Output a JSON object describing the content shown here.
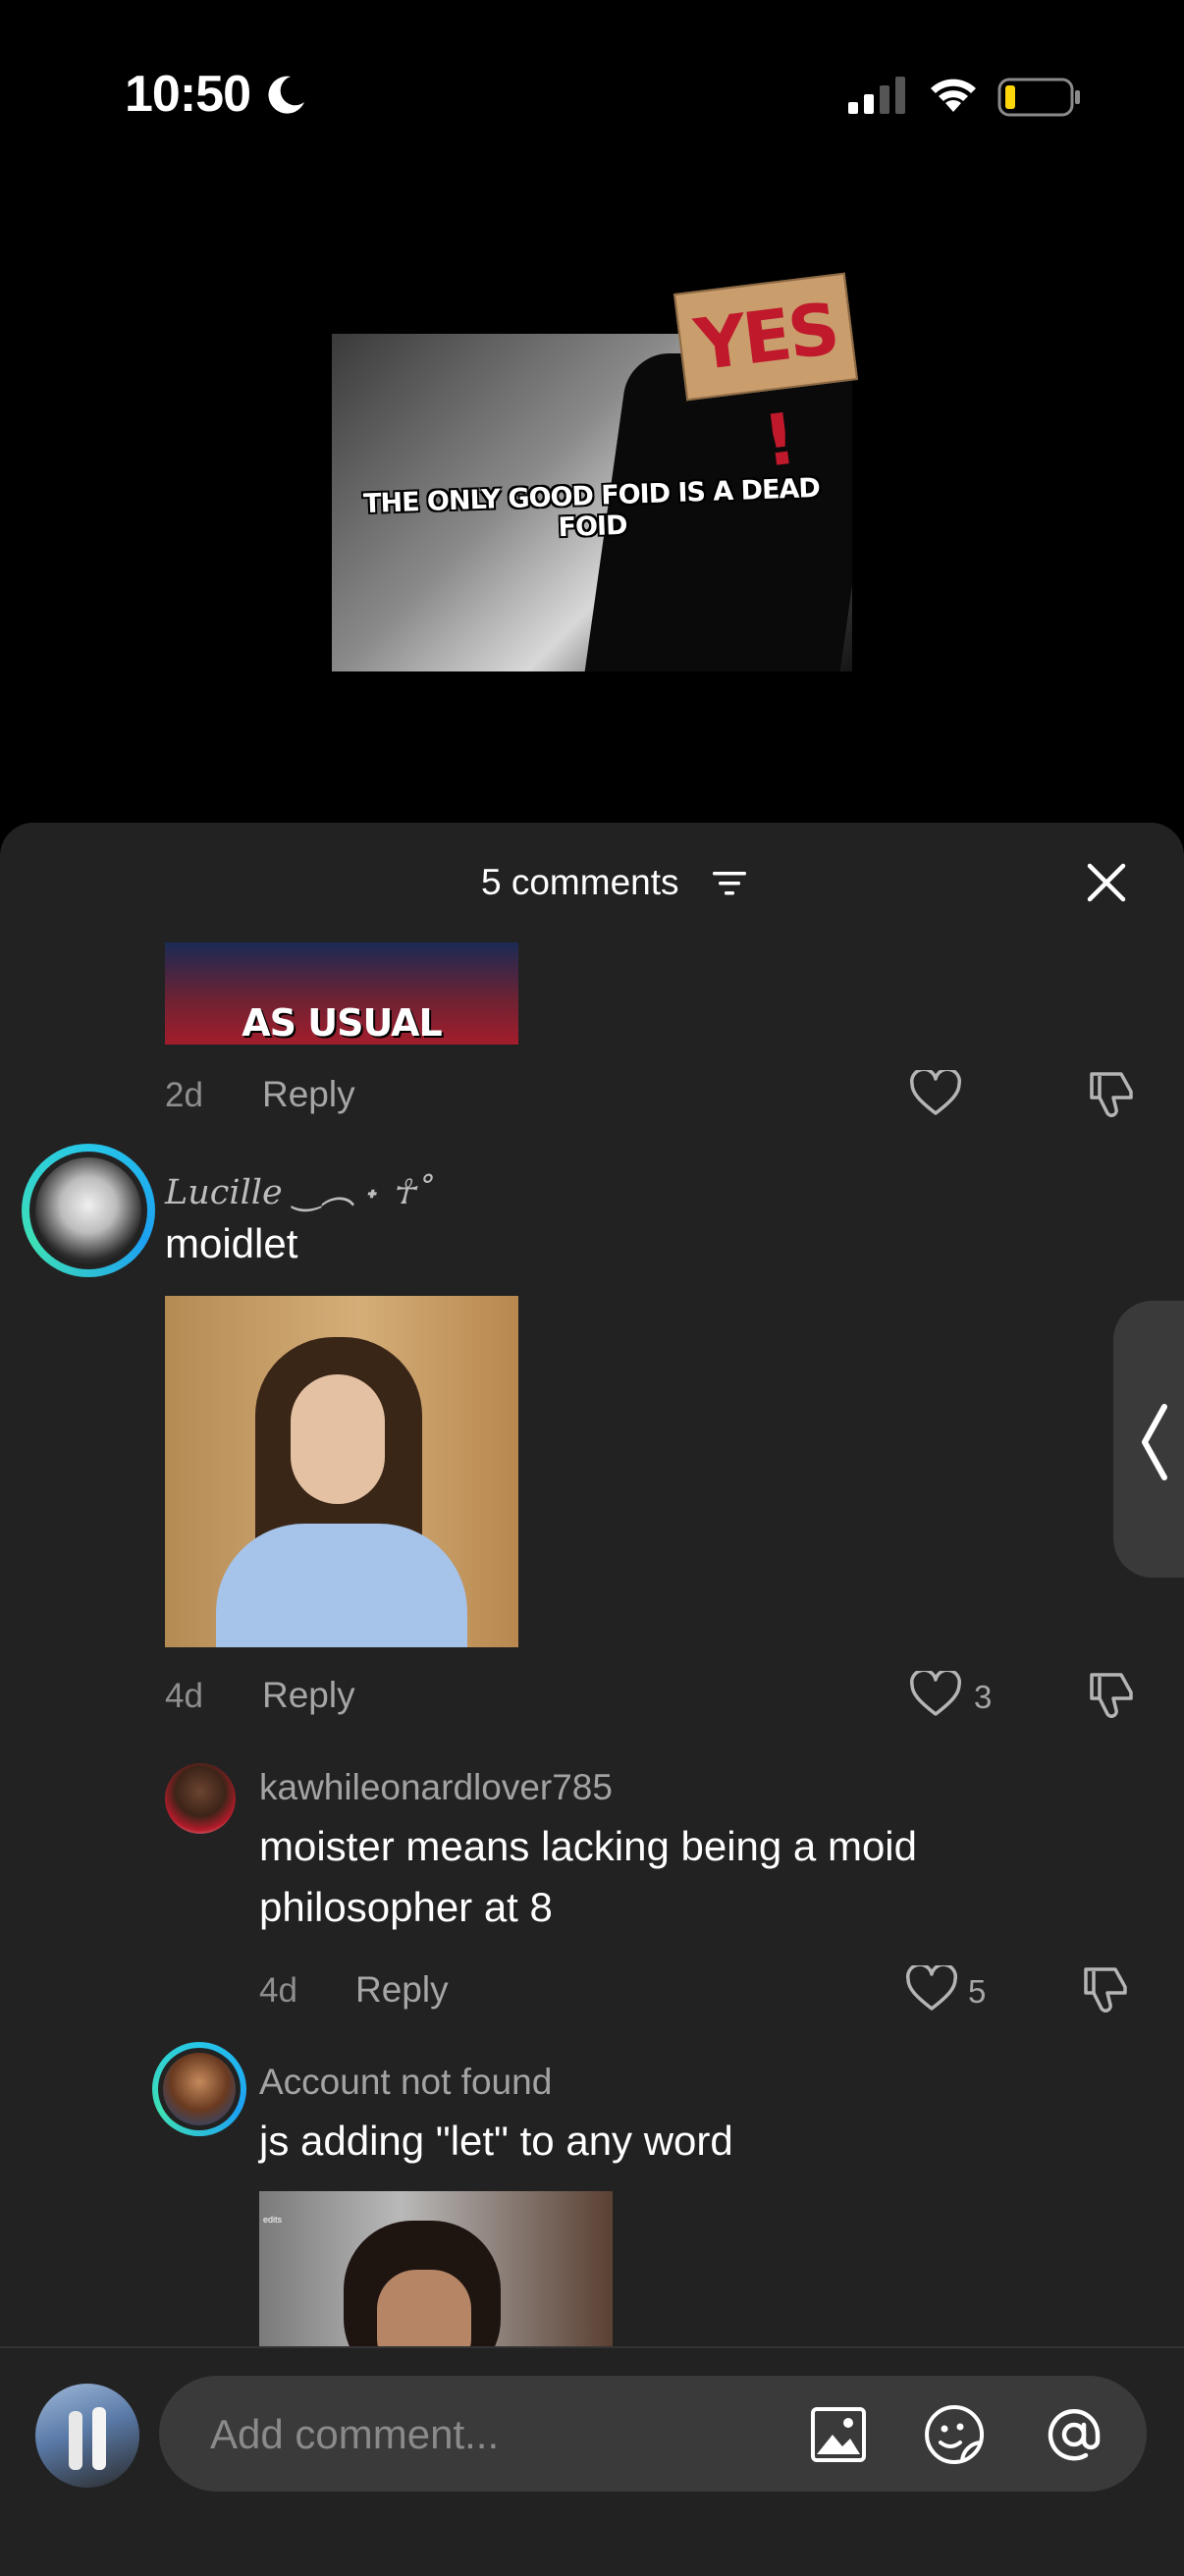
{
  "status_bar": {
    "time": "10:50"
  },
  "post": {
    "meme_text": "THE ONLY GOOD FOID IS A DEAD FOID",
    "sign_text": "YES !"
  },
  "sheet": {
    "comments_count": "5 comments"
  },
  "comments": [
    {
      "image_caption": "AS USUAL",
      "time": "2d",
      "reply_label": "Reply"
    },
    {
      "username": "Lucille ‿︵ ˖ ☥˚",
      "text": "moidlet",
      "time": "4d",
      "reply_label": "Reply",
      "likes": "3",
      "replies": [
        {
          "username": "kawhileonardlover785",
          "text_line1": "moister means lacking being a moid",
          "text_line2": "philosopher at 8",
          "time": "4d",
          "reply_label": "Reply",
          "likes": "5"
        },
        {
          "username": "Account not found",
          "text": "js adding \"let\" to any word",
          "image_caption": "edits"
        }
      ]
    }
  ],
  "input": {
    "placeholder": "Add comment..."
  },
  "icons": {
    "filter": "filter-icon",
    "close": "close-icon",
    "like": "heart-icon",
    "dislike": "thumbs-down-icon",
    "image": "image-icon",
    "sticker": "sticker-icon",
    "mention": "at-icon",
    "handle": "chevron-left-icon"
  }
}
